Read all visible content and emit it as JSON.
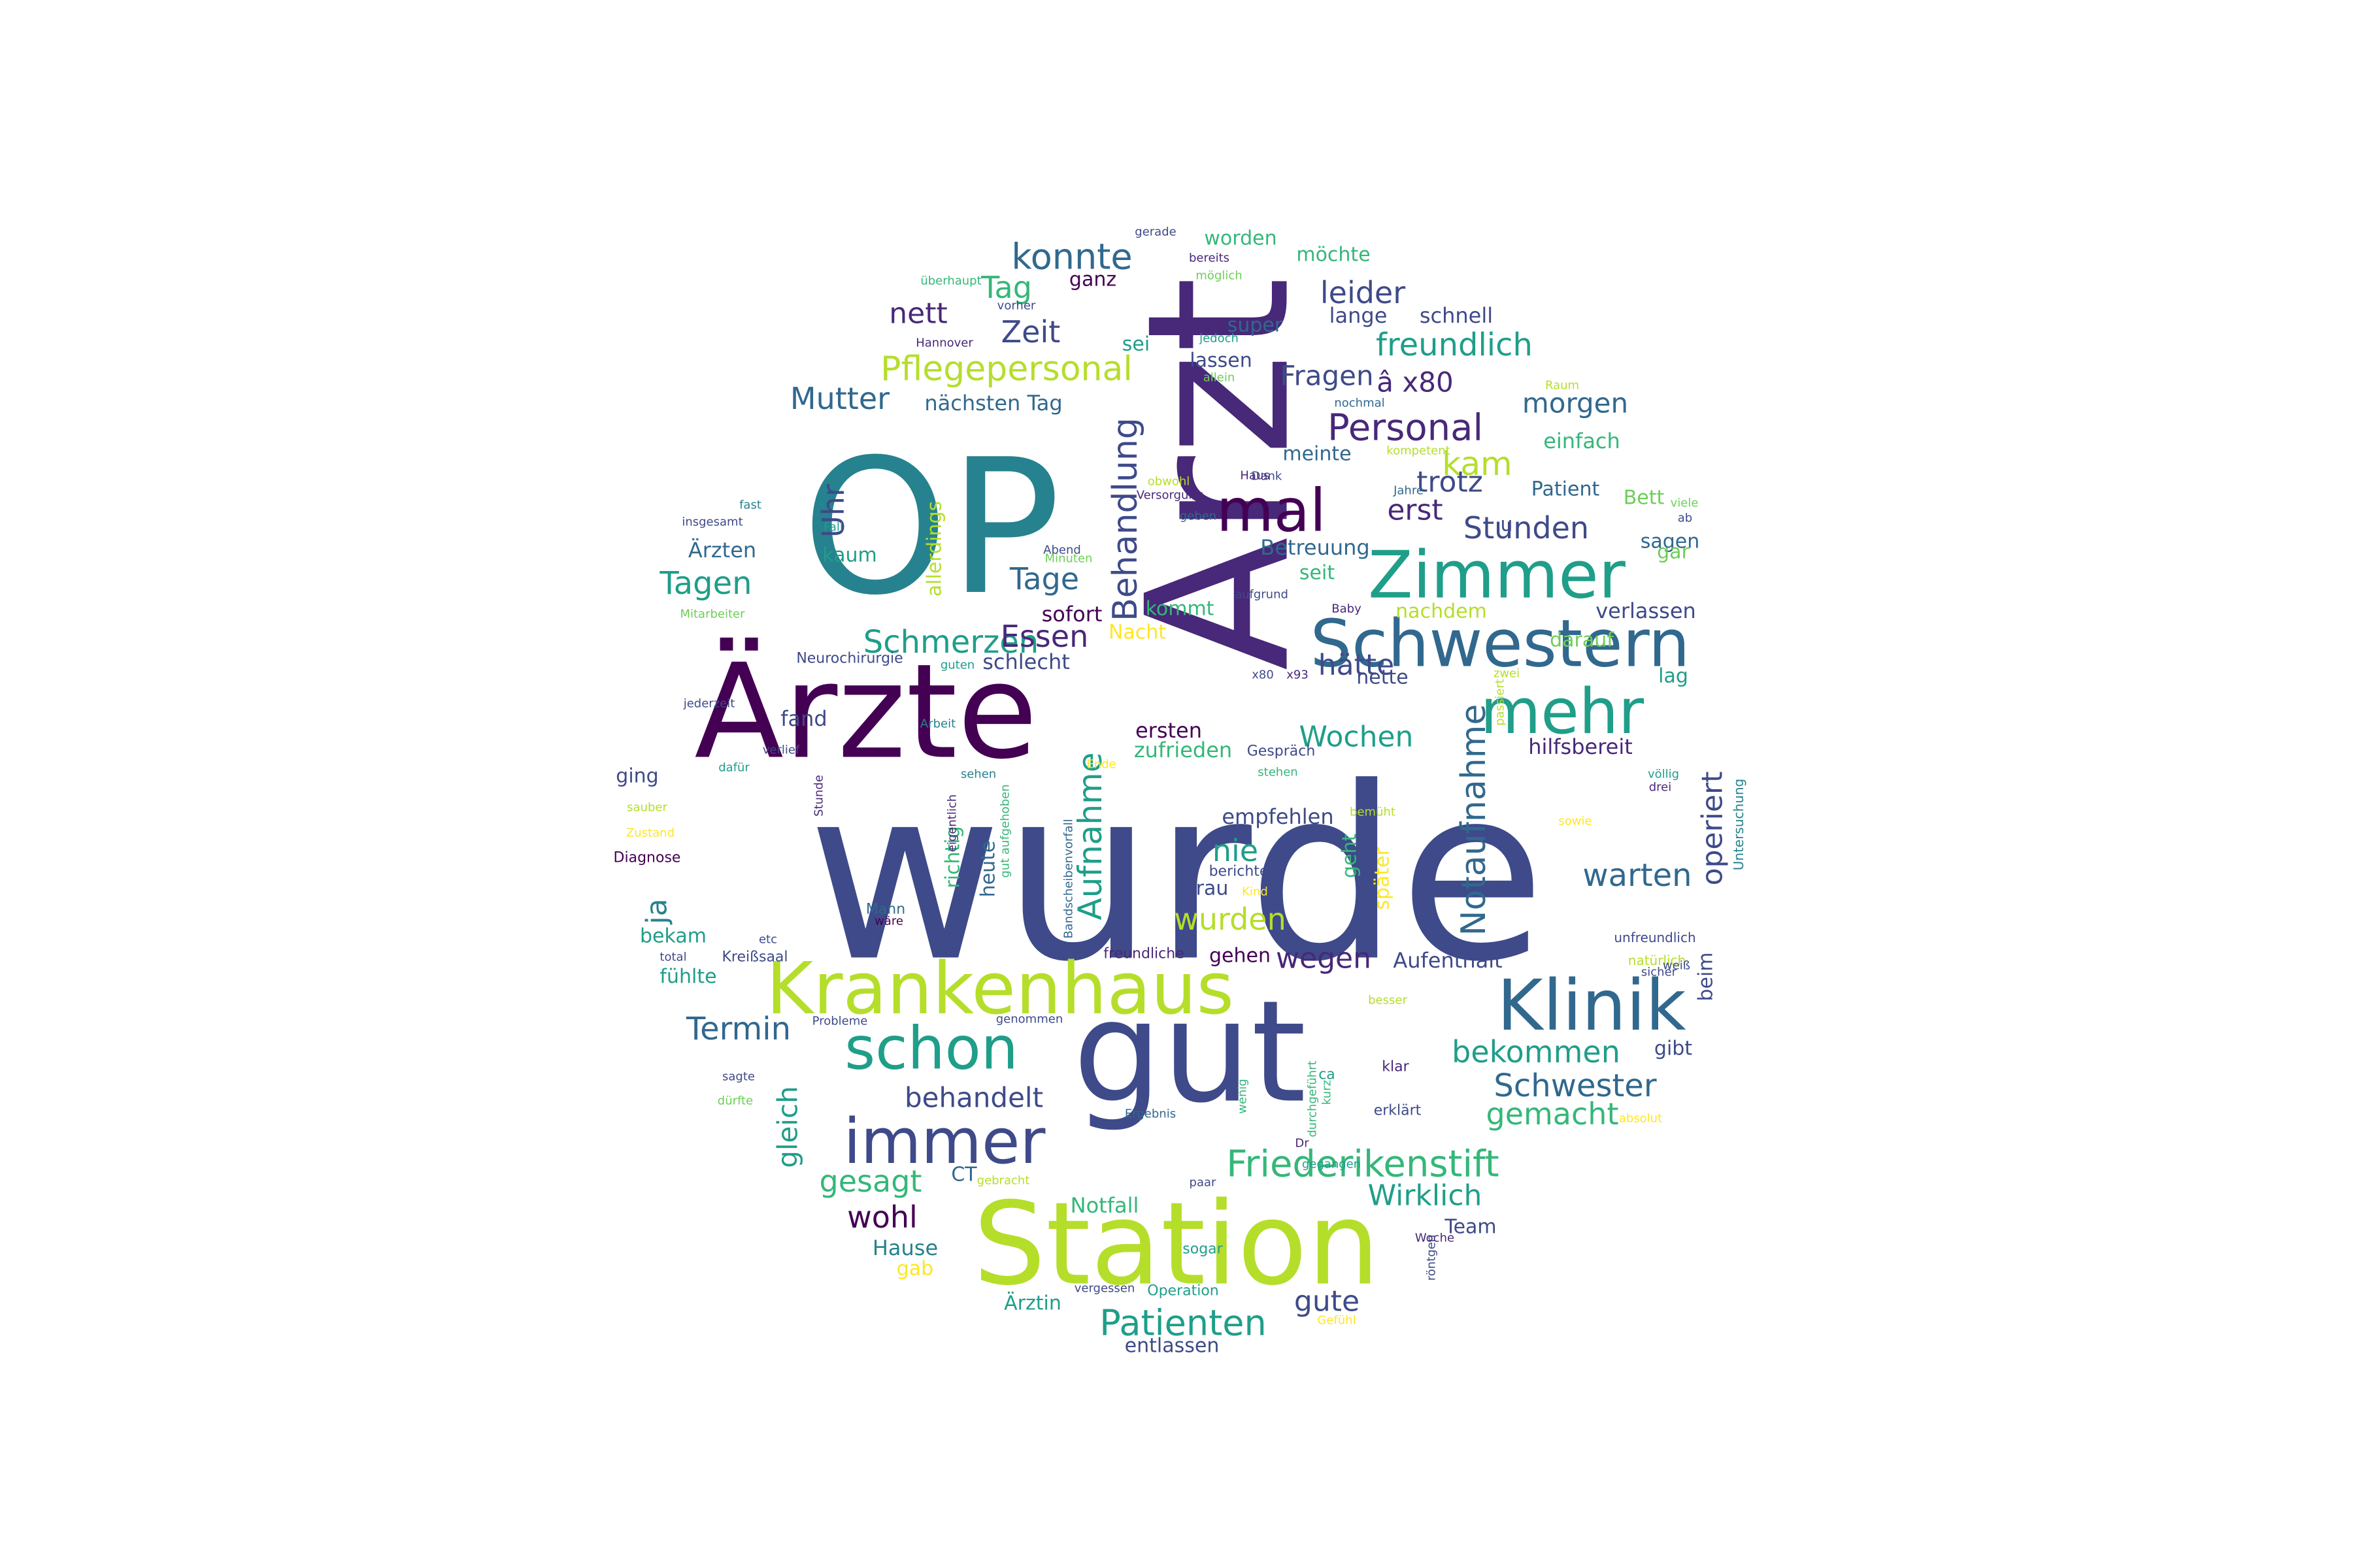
{
  "colors": [
    "#440154",
    "#482878",
    "#3e4a89",
    "#31688e",
    "#26828e",
    "#1f9e89",
    "#35b779",
    "#6ece58",
    "#b5de2b",
    "#fde725"
  ],
  "words": [
    {
      "t": "wurde",
      "w": 100
    },
    {
      "t": "Arzt",
      "w": 80
    },
    {
      "t": "OP",
      "w": 74
    },
    {
      "t": "gut",
      "w": 70
    },
    {
      "t": "Ärzte",
      "w": 64
    },
    {
      "t": "Station",
      "w": 60
    },
    {
      "t": "Krankenhaus",
      "w": 44
    },
    {
      "t": "Klinik",
      "w": 42
    },
    {
      "t": "Schwestern",
      "w": 40
    },
    {
      "t": "Zimmer",
      "w": 38
    },
    {
      "t": "mehr",
      "w": 36
    },
    {
      "t": "immer",
      "w": 36
    },
    {
      "t": "schon",
      "w": 34
    },
    {
      "t": "mal",
      "w": 34
    },
    {
      "t": "Friederikenstift",
      "w": 24
    },
    {
      "t": "konnte",
      "w": 22
    },
    {
      "t": "Personal",
      "w": 22
    },
    {
      "t": "Pflegepersonal",
      "w": 22
    },
    {
      "t": "Notaufnahme",
      "w": 22
    },
    {
      "t": "Behandlung",
      "w": 22
    },
    {
      "t": "freundlich",
      "w": 21
    },
    {
      "t": "Schwester",
      "w": 21
    },
    {
      "t": "Patienten",
      "w": 21
    },
    {
      "t": "Aufnahme",
      "w": 21
    },
    {
      "t": "Schmerzen",
      "w": 21
    },
    {
      "t": "Essen",
      "w": 21
    },
    {
      "t": "Stunden",
      "w": 20
    },
    {
      "t": "bekommen",
      "w": 20
    },
    {
      "t": "Tagen",
      "w": 20
    },
    {
      "t": "Termin",
      "w": 20
    },
    {
      "t": "Tage",
      "w": 20
    },
    {
      "t": "nie",
      "w": 20
    },
    {
      "t": "wurden",
      "w": 20
    },
    {
      "t": "warten",
      "w": 20
    },
    {
      "t": "gemacht",
      "w": 20
    },
    {
      "t": "wegen",
      "w": 20
    },
    {
      "t": "gesagt",
      "w": 20
    },
    {
      "t": "wohl",
      "w": 20
    },
    {
      "t": "operiert",
      "w": 20
    },
    {
      "t": "kam",
      "w": 20
    },
    {
      "t": "Mutter",
      "w": 19
    },
    {
      "t": "Zeit",
      "w": 19
    },
    {
      "t": "Tag",
      "w": 19
    },
    {
      "t": "Uhr",
      "w": 19
    },
    {
      "t": "leider",
      "w": 19
    },
    {
      "t": "behandelt",
      "w": 19
    },
    {
      "t": "hätte",
      "w": 19
    },
    {
      "t": "Wochen",
      "w": 19
    },
    {
      "t": "trotz",
      "w": 19
    },
    {
      "t": "erst",
      "w": 19
    },
    {
      "t": "gleich",
      "w": 19
    },
    {
      "t": "gute",
      "w": 19
    },
    {
      "t": "Wirklich",
      "w": 19
    },
    {
      "t": "morgen",
      "w": 18
    },
    {
      "t": "Fragen",
      "w": 18
    },
    {
      "t": "â x80",
      "w": 18
    },
    {
      "t": "nett",
      "w": 18
    },
    {
      "t": "ja",
      "w": 18
    },
    {
      "t": "empfehlen",
      "w": 15
    },
    {
      "t": "Notfall",
      "w": 15
    },
    {
      "t": "Aufenthalt",
      "w": 15
    },
    {
      "t": "Betreuung",
      "w": 15
    },
    {
      "t": "Hause",
      "w": 15
    },
    {
      "t": "verlassen",
      "w": 15
    },
    {
      "t": "hilfsbereit",
      "w": 15
    },
    {
      "t": "ersten",
      "w": 15
    },
    {
      "t": "sofort",
      "w": 15
    },
    {
      "t": "schlecht",
      "w": 15
    },
    {
      "t": "zufrieden",
      "w": 15
    },
    {
      "t": "Ärzten",
      "w": 15
    },
    {
      "t": "fand",
      "w": 15
    },
    {
      "t": "nächsten Tag",
      "w": 15
    },
    {
      "t": "lange",
      "w": 15
    },
    {
      "t": "schnell",
      "w": 15
    },
    {
      "t": "einfach",
      "w": 15
    },
    {
      "t": "Patient",
      "w": 14
    },
    {
      "t": "meinte",
      "w": 14
    },
    {
      "t": "sagen",
      "w": 14
    },
    {
      "t": "worden",
      "w": 14
    },
    {
      "t": "möchte",
      "w": 14
    },
    {
      "t": "super",
      "w": 14
    },
    {
      "t": "lassen",
      "w": 14
    },
    {
      "t": "ganz",
      "w": 14
    },
    {
      "t": "sei",
      "w": 14
    },
    {
      "t": "nachdem",
      "w": 14
    },
    {
      "t": "seit",
      "w": 14
    },
    {
      "t": "kommt",
      "w": 14
    },
    {
      "t": "kaum",
      "w": 14
    },
    {
      "t": "allerdings",
      "w": 14
    },
    {
      "t": "richtig",
      "w": 14
    },
    {
      "t": "heute",
      "w": 14
    },
    {
      "t": "Frau",
      "w": 14
    },
    {
      "t": "gehen",
      "w": 14
    },
    {
      "t": "bekam",
      "w": 14
    },
    {
      "t": "fühlte",
      "w": 14
    },
    {
      "t": "ging",
      "w": 14
    },
    {
      "t": "gibt",
      "w": 14
    },
    {
      "t": "darauf",
      "w": 14
    },
    {
      "t": "lag",
      "w": 14
    },
    {
      "t": "nette",
      "w": 14
    },
    {
      "t": "Team",
      "w": 14
    },
    {
      "t": "Ärztin",
      "w": 14
    },
    {
      "t": "entlassen",
      "w": 14
    },
    {
      "t": "gab",
      "w": 14
    },
    {
      "t": "CT",
      "w": 14
    },
    {
      "t": "später",
      "w": 14
    },
    {
      "t": "geht",
      "w": 14
    },
    {
      "t": "beim",
      "w": 14
    },
    {
      "t": "Nacht",
      "w": 14
    },
    {
      "t": "Bett",
      "w": 14
    },
    {
      "t": "gar",
      "w": 14
    },
    {
      "t": "u",
      "w": 14
    },
    {
      "t": "Dank",
      "w": 9
    },
    {
      "t": "Haus",
      "w": 9
    },
    {
      "t": "Jahre",
      "w": 9
    },
    {
      "t": "Abend",
      "w": 9
    },
    {
      "t": "Minuten",
      "w": 9
    },
    {
      "t": "aufgrund",
      "w": 9
    },
    {
      "t": "Baby",
      "w": 9
    },
    {
      "t": "x80",
      "w": 9
    },
    {
      "t": "x93",
      "w": 9
    },
    {
      "t": "Gespräch",
      "w": 10
    },
    {
      "t": "stehen",
      "w": 9
    },
    {
      "t": "bemüht",
      "w": 9
    },
    {
      "t": "berichten",
      "w": 10
    },
    {
      "t": "Kind",
      "w": 9
    },
    {
      "t": "BG",
      "w": 9
    },
    {
      "t": "unfreundlich",
      "w": 10
    },
    {
      "t": "natürlich",
      "w": 10
    },
    {
      "t": "sicher",
      "w": 9
    },
    {
      "t": "besser",
      "w": 9
    },
    {
      "t": "klar",
      "w": 10
    },
    {
      "t": "erklärt",
      "w": 10
    },
    {
      "t": "absolut",
      "w": 9
    },
    {
      "t": "kurz",
      "w": 9
    },
    {
      "t": "ca",
      "w": 10
    },
    {
      "t": "durchgeführt",
      "w": 9
    },
    {
      "t": "wenig",
      "w": 9
    },
    {
      "t": "Dr",
      "w": 9
    },
    {
      "t": "gegangen",
      "w": 9
    },
    {
      "t": "paar",
      "w": 9
    },
    {
      "t": "röntgen",
      "w": 9
    },
    {
      "t": "Woche",
      "w": 9
    },
    {
      "t": "Operation",
      "w": 10
    },
    {
      "t": "vergessen",
      "w": 9
    },
    {
      "t": "Gefühl",
      "w": 9
    },
    {
      "t": "sogar",
      "w": 10
    },
    {
      "t": "gebracht",
      "w": 9
    },
    {
      "t": "Ergebnis",
      "w": 9
    },
    {
      "t": "genommen",
      "w": 9
    },
    {
      "t": "freundliche",
      "w": 10
    },
    {
      "t": "Mann",
      "w": 10
    },
    {
      "t": "wäre",
      "w": 9
    },
    {
      "t": "Kreißsaal",
      "w": 10
    },
    {
      "t": "Probleme",
      "w": 9
    },
    {
      "t": "sagte",
      "w": 9
    },
    {
      "t": "dürfte",
      "w": 9
    },
    {
      "t": "total",
      "w": 9
    },
    {
      "t": "etc",
      "w": 9
    },
    {
      "t": "Diagnose",
      "w": 10
    },
    {
      "t": "Zustand",
      "w": 9
    },
    {
      "t": "sauber",
      "w": 9
    },
    {
      "t": "dafür",
      "w": 9
    },
    {
      "t": "verlief",
      "w": 9
    },
    {
      "t": "Arbeit",
      "w": 9
    },
    {
      "t": "jederzeit",
      "w": 9
    },
    {
      "t": "Neurochirurgie",
      "w": 10
    },
    {
      "t": "guten",
      "w": 9
    },
    {
      "t": "Mitarbeiter",
      "w": 9
    },
    {
      "t": "Fall",
      "w": 9
    },
    {
      "t": "insgesamt",
      "w": 9
    },
    {
      "t": "fast",
      "w": 9
    },
    {
      "t": "überhaupt",
      "w": 9
    },
    {
      "t": "vorher",
      "w": 9
    },
    {
      "t": "Hannover",
      "w": 9
    },
    {
      "t": "gerade",
      "w": 9
    },
    {
      "t": "bereits",
      "w": 9
    },
    {
      "t": "möglich",
      "w": 9
    },
    {
      "t": "jedoch",
      "w": 9
    },
    {
      "t": "allein",
      "w": 9
    },
    {
      "t": "Raum",
      "w": 9
    },
    {
      "t": "nochmal",
      "w": 9
    },
    {
      "t": "kompetent",
      "w": 9
    },
    {
      "t": "obwohl",
      "w": 9
    },
    {
      "t": "Versorgung",
      "w": 9
    },
    {
      "t": "geben",
      "w": 9
    },
    {
      "t": "viele",
      "w": 9
    },
    {
      "t": "ab",
      "w": 9
    },
    {
      "t": "zwei",
      "w": 9
    },
    {
      "t": "passiert",
      "w": 9
    },
    {
      "t": "völlig",
      "w": 9
    },
    {
      "t": "drei",
      "w": 9
    },
    {
      "t": "Untersuchung",
      "w": 10
    },
    {
      "t": "sowie",
      "w": 9
    },
    {
      "t": "weiß",
      "w": 9
    },
    {
      "t": "Ende",
      "w": 9
    },
    {
      "t": "sehen",
      "w": 9
    },
    {
      "t": "eigentlich",
      "w": 9
    },
    {
      "t": "Stunde",
      "w": 9
    },
    {
      "t": "Bandscheibenvorfall",
      "w": 9
    },
    {
      "t": "gut aufgehoben",
      "w": 8
    }
  ]
}
